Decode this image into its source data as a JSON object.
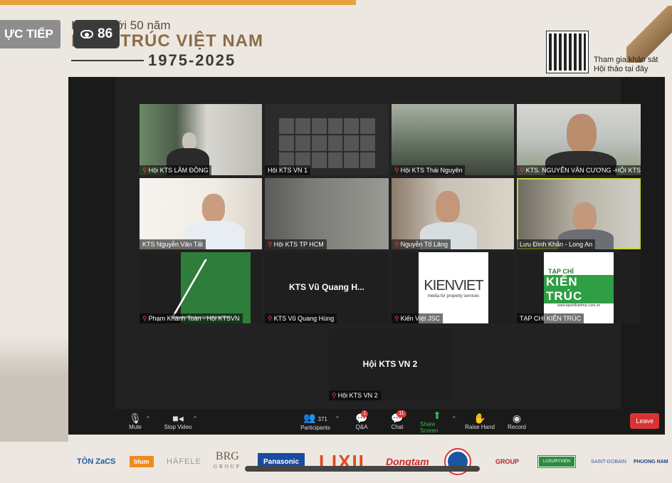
{
  "overlay": {
    "live_label": "ỰC TIẾP",
    "viewer_count": "86"
  },
  "event": {
    "line1": "Hướng tới 50 năm",
    "line2": "KIẾN TRÚC VIỆT NAM",
    "years": "1975-2025"
  },
  "survey": {
    "line1": "Tham gia khảo sát",
    "line2": "Hội thảo tại đây"
  },
  "tiles": [
    {
      "name": "Hội KTS LÂM ĐỒNG",
      "muted": true
    },
    {
      "name": "Hội KTS VN 1",
      "muted": false
    },
    {
      "name": "Hội KTS Thái Nguyên",
      "muted": true
    },
    {
      "name": "KTS. NGUYỄN VĂN CƯƠNG -HỘI KTS TN",
      "muted": true
    },
    {
      "name": "KTS Nguyễn Văn Tất",
      "muted": false
    },
    {
      "name": "Hội KTS TP HCM",
      "muted": true
    },
    {
      "name": "Nguyễn Tố Lăng",
      "muted": true
    },
    {
      "name": "Lưu Đình Khẩn - Long An",
      "muted": false
    },
    {
      "name": "Phạm Khánh Toàn - Hội KTSVN",
      "muted": true
    },
    {
      "name": "KTS Vũ Quang Hùng",
      "muted": true,
      "placeholder": "KTS Vũ Quang H..."
    },
    {
      "name": "Kiến Việt JSC",
      "muted": true
    },
    {
      "name": "TẠP CHÍ KIẾN TRÚC",
      "muted": false
    },
    {
      "name": "Hội KTS VN 2",
      "muted": true,
      "placeholder": "Hội KTS VN 2"
    }
  ],
  "brands": {
    "kienviet_main": "KIENVIET",
    "kienviet_sub": "media for property services",
    "tapchi_top": "TẠP CHÍ",
    "tapchi_main": "KIẾN TRÚC",
    "tapchi_url": "www.tapchikientruc.com.vn"
  },
  "toolbar": {
    "mute": "Mute",
    "stop_video": "Stop Video",
    "participants": "Participants",
    "participants_count": "371",
    "qa": "Q&A",
    "qa_badge": "1",
    "chat": "Chat",
    "chat_badge": "11",
    "share_screen": "Share Screen",
    "raise_hand": "Raise Hand",
    "record": "Record",
    "leave": "Leave"
  },
  "sponsors": {
    "ton": "TÔN ZaCS",
    "blum": "blum",
    "hafele": "HÄFELE",
    "brg": "BRG",
    "brg_sub": "GROUP",
    "panasonic": "Panasonic",
    "lixil": "LIXIL",
    "dongtam": "Dongtam",
    "vin": "GROUP",
    "luxury": "LUXURYVIEN",
    "saint": "SAINT-GOBAIN",
    "phuong": "PHUONG NAM"
  },
  "colors": {
    "accent": "#e6a33b",
    "active_speaker": "#c5d63c",
    "leave": "#d63434",
    "share": "#2fbf4f"
  }
}
